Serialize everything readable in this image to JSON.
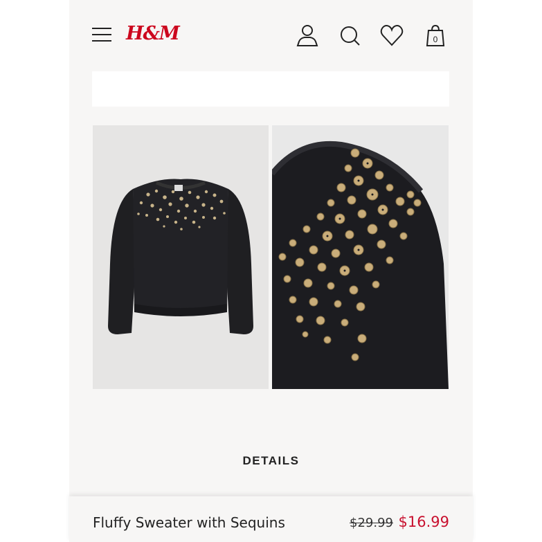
{
  "header": {
    "brand": "H&M",
    "icons": [
      "menu-icon",
      "account-icon",
      "search-icon",
      "favorites-icon",
      "shopping-bag-icon"
    ],
    "bag_count": "0"
  },
  "search": {
    "placeholder": ""
  },
  "product": {
    "images": [
      "sweater-front-photo",
      "sweater-sequin-detail-photo"
    ],
    "details_label": "DETAILS",
    "name": "Fluffy Sweater with Sequins",
    "old_price": "$29.99",
    "price": "$16.99"
  },
  "colors": {
    "brand": "#cc071e",
    "sale": "#c8102e",
    "background": "#f7f6f5"
  }
}
